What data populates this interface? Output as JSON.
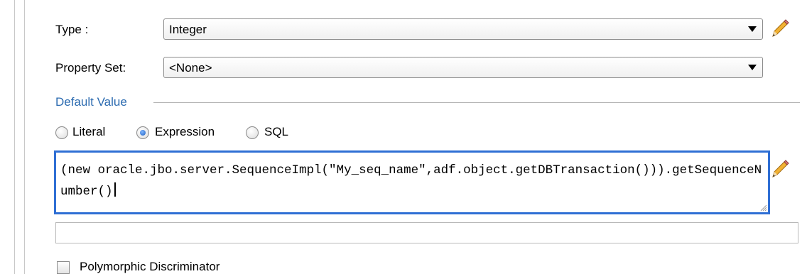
{
  "type_field": {
    "label": "Type :",
    "value": "Integer"
  },
  "property_set_field": {
    "label": "Property Set:",
    "value": "<None>"
  },
  "default_value": {
    "section_title": "Default Value",
    "options": [
      {
        "label": "Literal",
        "checked": false
      },
      {
        "label": "Expression",
        "checked": true
      },
      {
        "label": "SQL",
        "checked": false
      }
    ],
    "expression_text": "(new oracle.jbo.server.SequenceImpl(\"My_seq_name\",adf.object.getDBTransaction())).getSequenceNumber()",
    "secondary_value": ""
  },
  "polymorphic_discriminator": {
    "label": "Polymorphic Discriminator",
    "checked": false
  },
  "icons": {
    "edit_type": "pencil-icon",
    "edit_expression": "pencil-icon"
  },
  "colors": {
    "section_title": "#2c6bb0",
    "focus_border": "#2f6fd4"
  }
}
